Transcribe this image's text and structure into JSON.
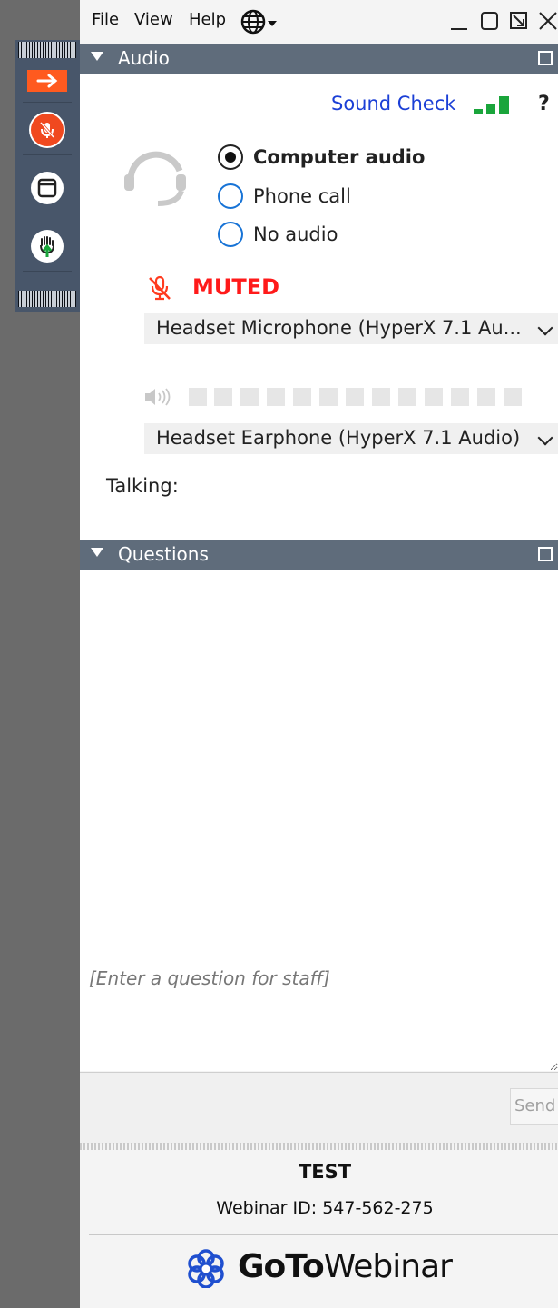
{
  "menu": {
    "items": [
      "File",
      "View",
      "Help"
    ],
    "language_icon": "globe-icon"
  },
  "window_controls": [
    "minimize-icon",
    "maximize-icon",
    "restore-icon",
    "close-icon"
  ],
  "toolbar": {
    "buttons": [
      {
        "name": "collapse-arrow-icon",
        "color": "#ff5a1f"
      },
      {
        "name": "microphone-muted-icon",
        "color": "#f0491f"
      },
      {
        "name": "window-icon",
        "color": "#ffffff"
      },
      {
        "name": "raise-hand-icon",
        "color": "#ffffff"
      }
    ]
  },
  "audio": {
    "header": "Audio",
    "sound_check": "Sound Check",
    "help": "?",
    "options": [
      "Computer audio",
      "Phone call",
      "No audio"
    ],
    "selected_option": "Computer audio",
    "muted_label": "MUTED",
    "microphone": "Headset Microphone (HyperX 7.1 Au...",
    "speaker": "Headset Earphone (HyperX 7.1 Audio)",
    "talking_label": "Talking:"
  },
  "questions": {
    "header": "Questions",
    "placeholder": "[Enter a question for staff]",
    "send_label": "Send"
  },
  "footer": {
    "event_title": "TEST",
    "webinar_id": "Webinar ID: 547-562-275",
    "logo_bold": "GoTo",
    "logo_light": "Webinar"
  },
  "colors": {
    "header_bg": "#5f6c7b",
    "toolbar_bg": "#48566a",
    "muted_red": "#ff1a1a",
    "link_blue": "#1b3fd6",
    "level_green": "#1aa53b",
    "logo_blue": "#1f4fcf"
  }
}
